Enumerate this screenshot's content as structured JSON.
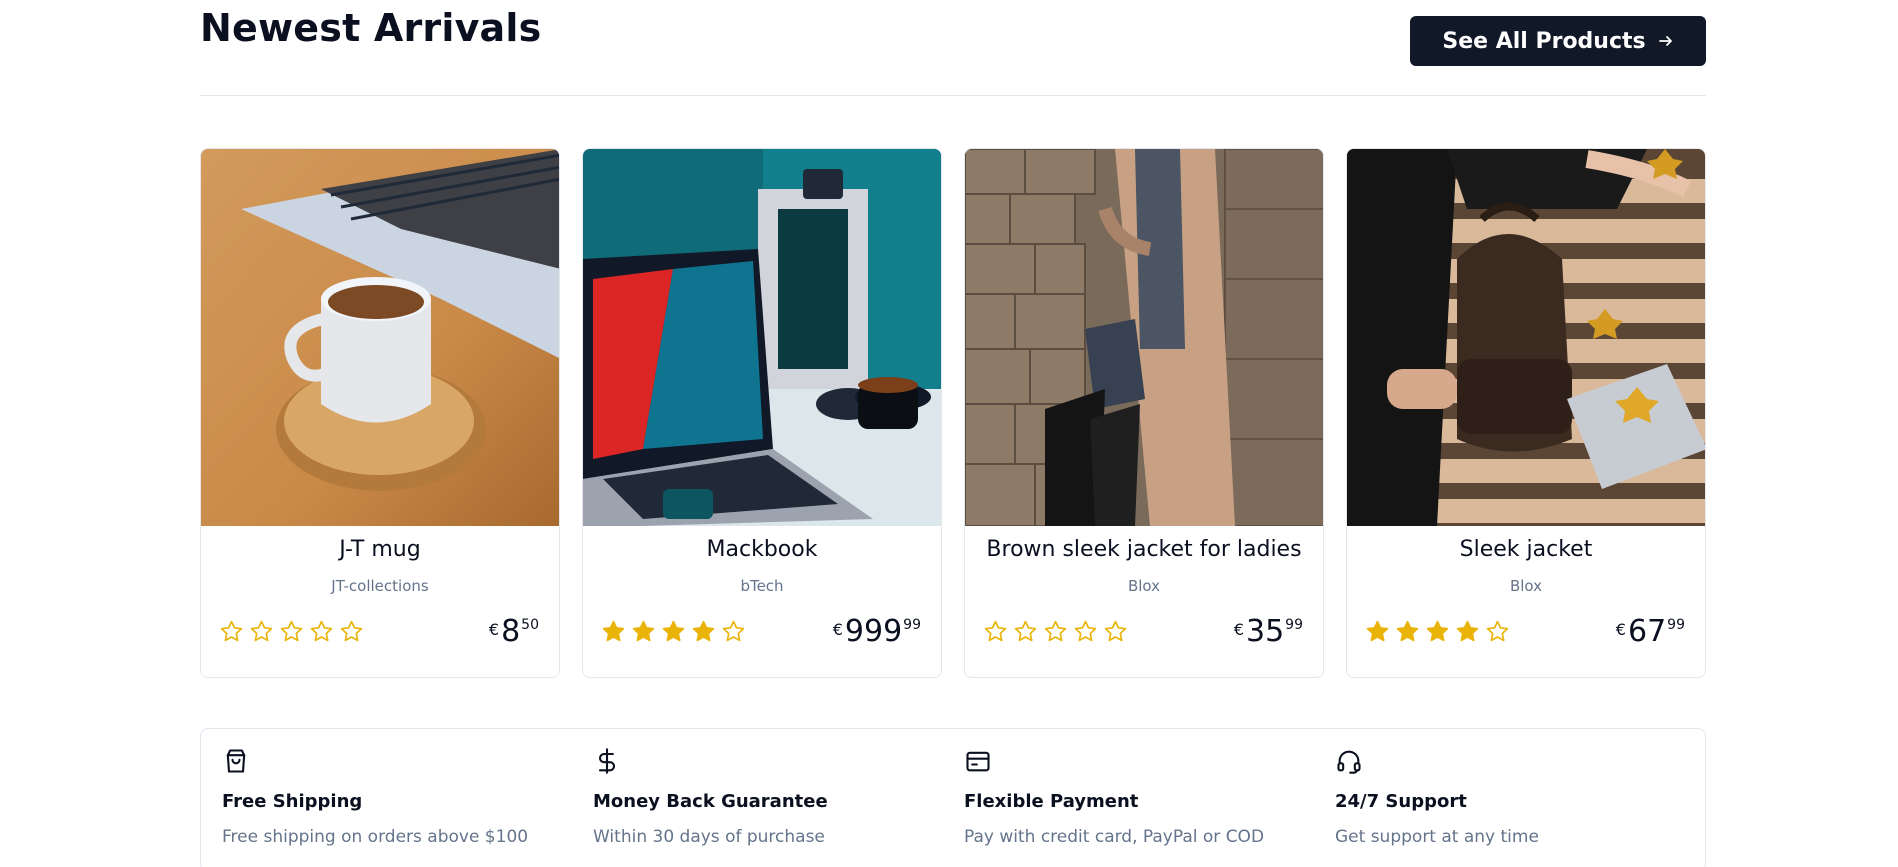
{
  "section": {
    "title": "Newest Arrivals",
    "see_all_label": "See All Products",
    "see_all_icon": "arrow-right-icon"
  },
  "products": [
    {
      "name": "J-T mug",
      "brand": "JT-collections",
      "rating": 0,
      "currency": "€",
      "price_main": "8",
      "price_cents": "50",
      "image": "coffee-mug-photo"
    },
    {
      "name": "Mackbook",
      "brand": "bTech",
      "rating": 4,
      "currency": "€",
      "price_main": "999",
      "price_cents": "99",
      "image": "laptop-photo"
    },
    {
      "name": "Brown sleek jacket for ladies",
      "brand": "Blox",
      "rating": 0,
      "currency": "€",
      "price_main": "35",
      "price_cents": "99",
      "image": "brown-coat-photo"
    },
    {
      "name": "Sleek jacket",
      "brand": "Blox",
      "rating": 4,
      "currency": "€",
      "price_main": "67",
      "price_cents": "99",
      "image": "backpack-photo"
    }
  ],
  "features": [
    {
      "icon": "shopping-bag-icon",
      "title": "Free Shipping",
      "description": "Free shipping on orders above $100"
    },
    {
      "icon": "dollar-icon",
      "title": "Money Back Guarantee",
      "description": "Within 30 days of purchase"
    },
    {
      "icon": "wallet-icon",
      "title": "Flexible Payment",
      "description": "Pay with credit card, PayPal or COD"
    },
    {
      "icon": "headset-icon",
      "title": "24/7 Support",
      "description": "Get support at any time"
    }
  ],
  "colors": {
    "star": "#eab308",
    "button_bg": "#111827",
    "muted_text": "#64748b"
  }
}
